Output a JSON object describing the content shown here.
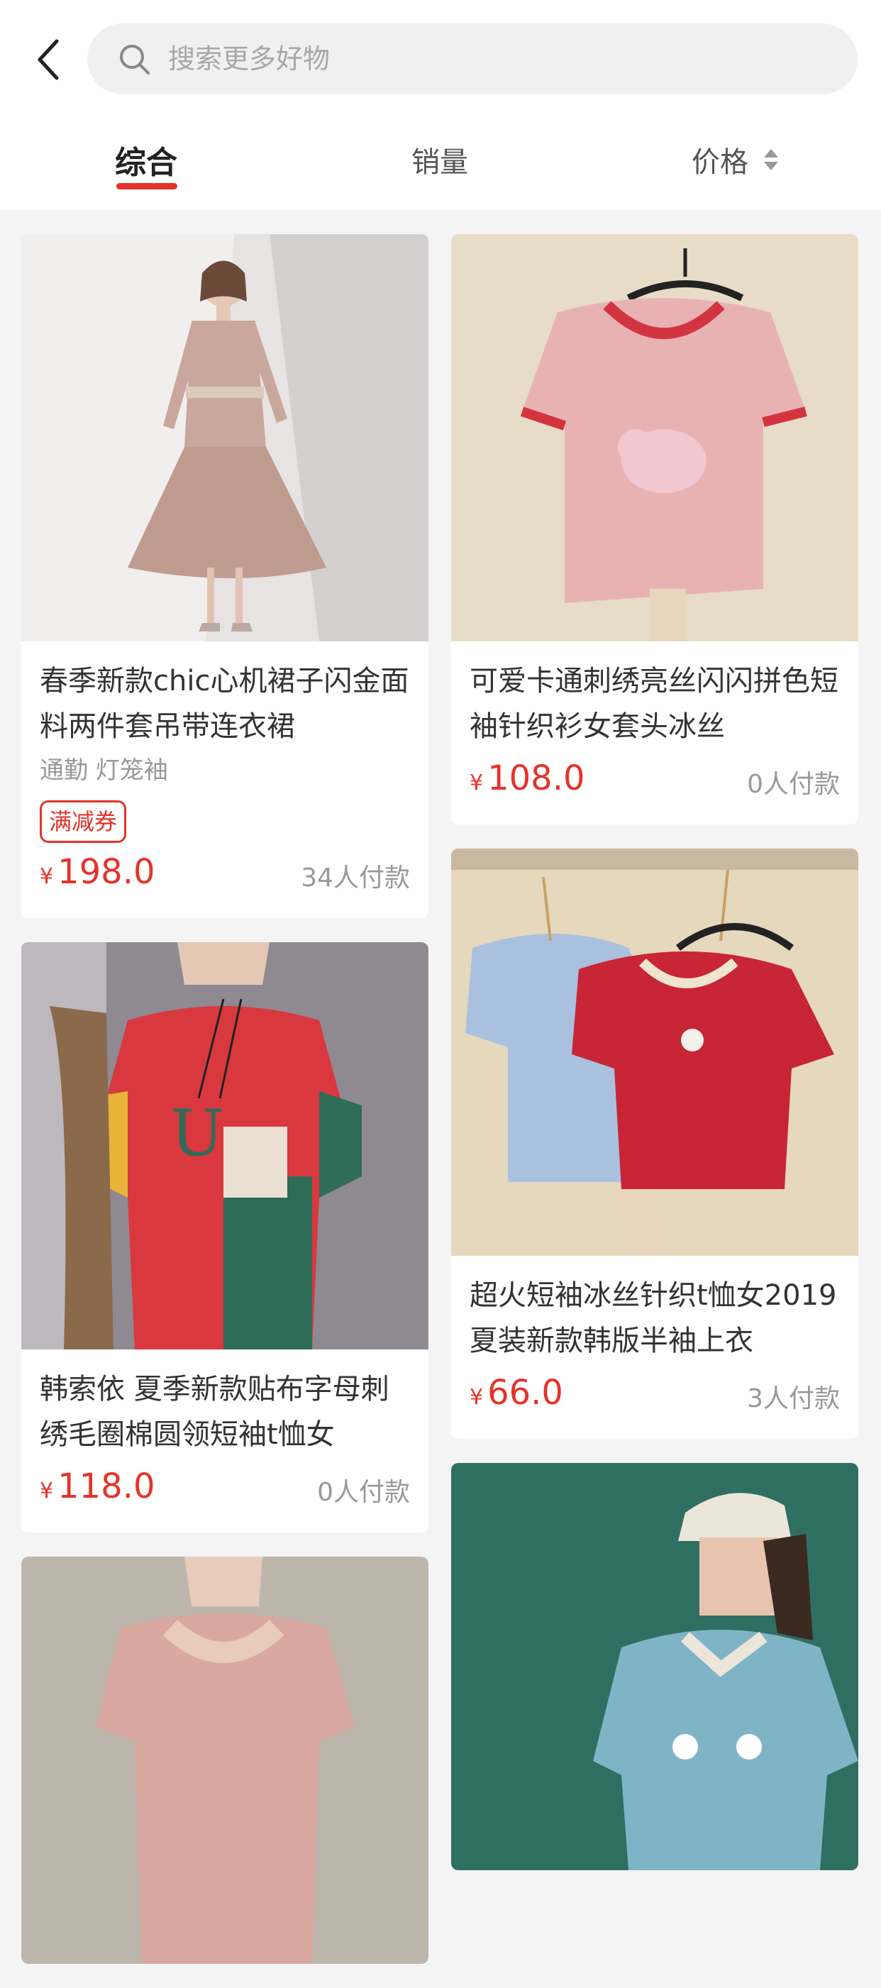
{
  "search": {
    "placeholder": "搜索更多好物"
  },
  "tabs": [
    {
      "label": "综合"
    },
    {
      "label": "销量"
    },
    {
      "label": "价格"
    }
  ],
  "colors": {
    "accent": "#e5332a",
    "background": "#f4f4f4"
  },
  "products_left": [
    {
      "title": "春季新款chic心机裙子闪金面料两件套吊带连衣裙",
      "tags": "通勤 灯笼袖",
      "coupon": "满减券",
      "currency": "¥",
      "price": "198.0",
      "paid": "34人付款"
    },
    {
      "title": "韩索依 夏季新款贴布字母刺绣毛圈棉圆领短袖t恤女",
      "currency": "¥",
      "price": "118.0",
      "paid": "0人付款"
    },
    {
      "title": ""
    }
  ],
  "products_right": [
    {
      "title": "可爱卡通刺绣亮丝闪闪拼色短袖针织衫女套头冰丝",
      "currency": "¥",
      "price": "108.0",
      "paid": "0人付款"
    },
    {
      "title": "超火短袖冰丝针织t恤女2019夏装新款韩版半袖上衣",
      "currency": "¥",
      "price": "66.0",
      "paid": "3人付款"
    },
    {
      "title": ""
    }
  ]
}
